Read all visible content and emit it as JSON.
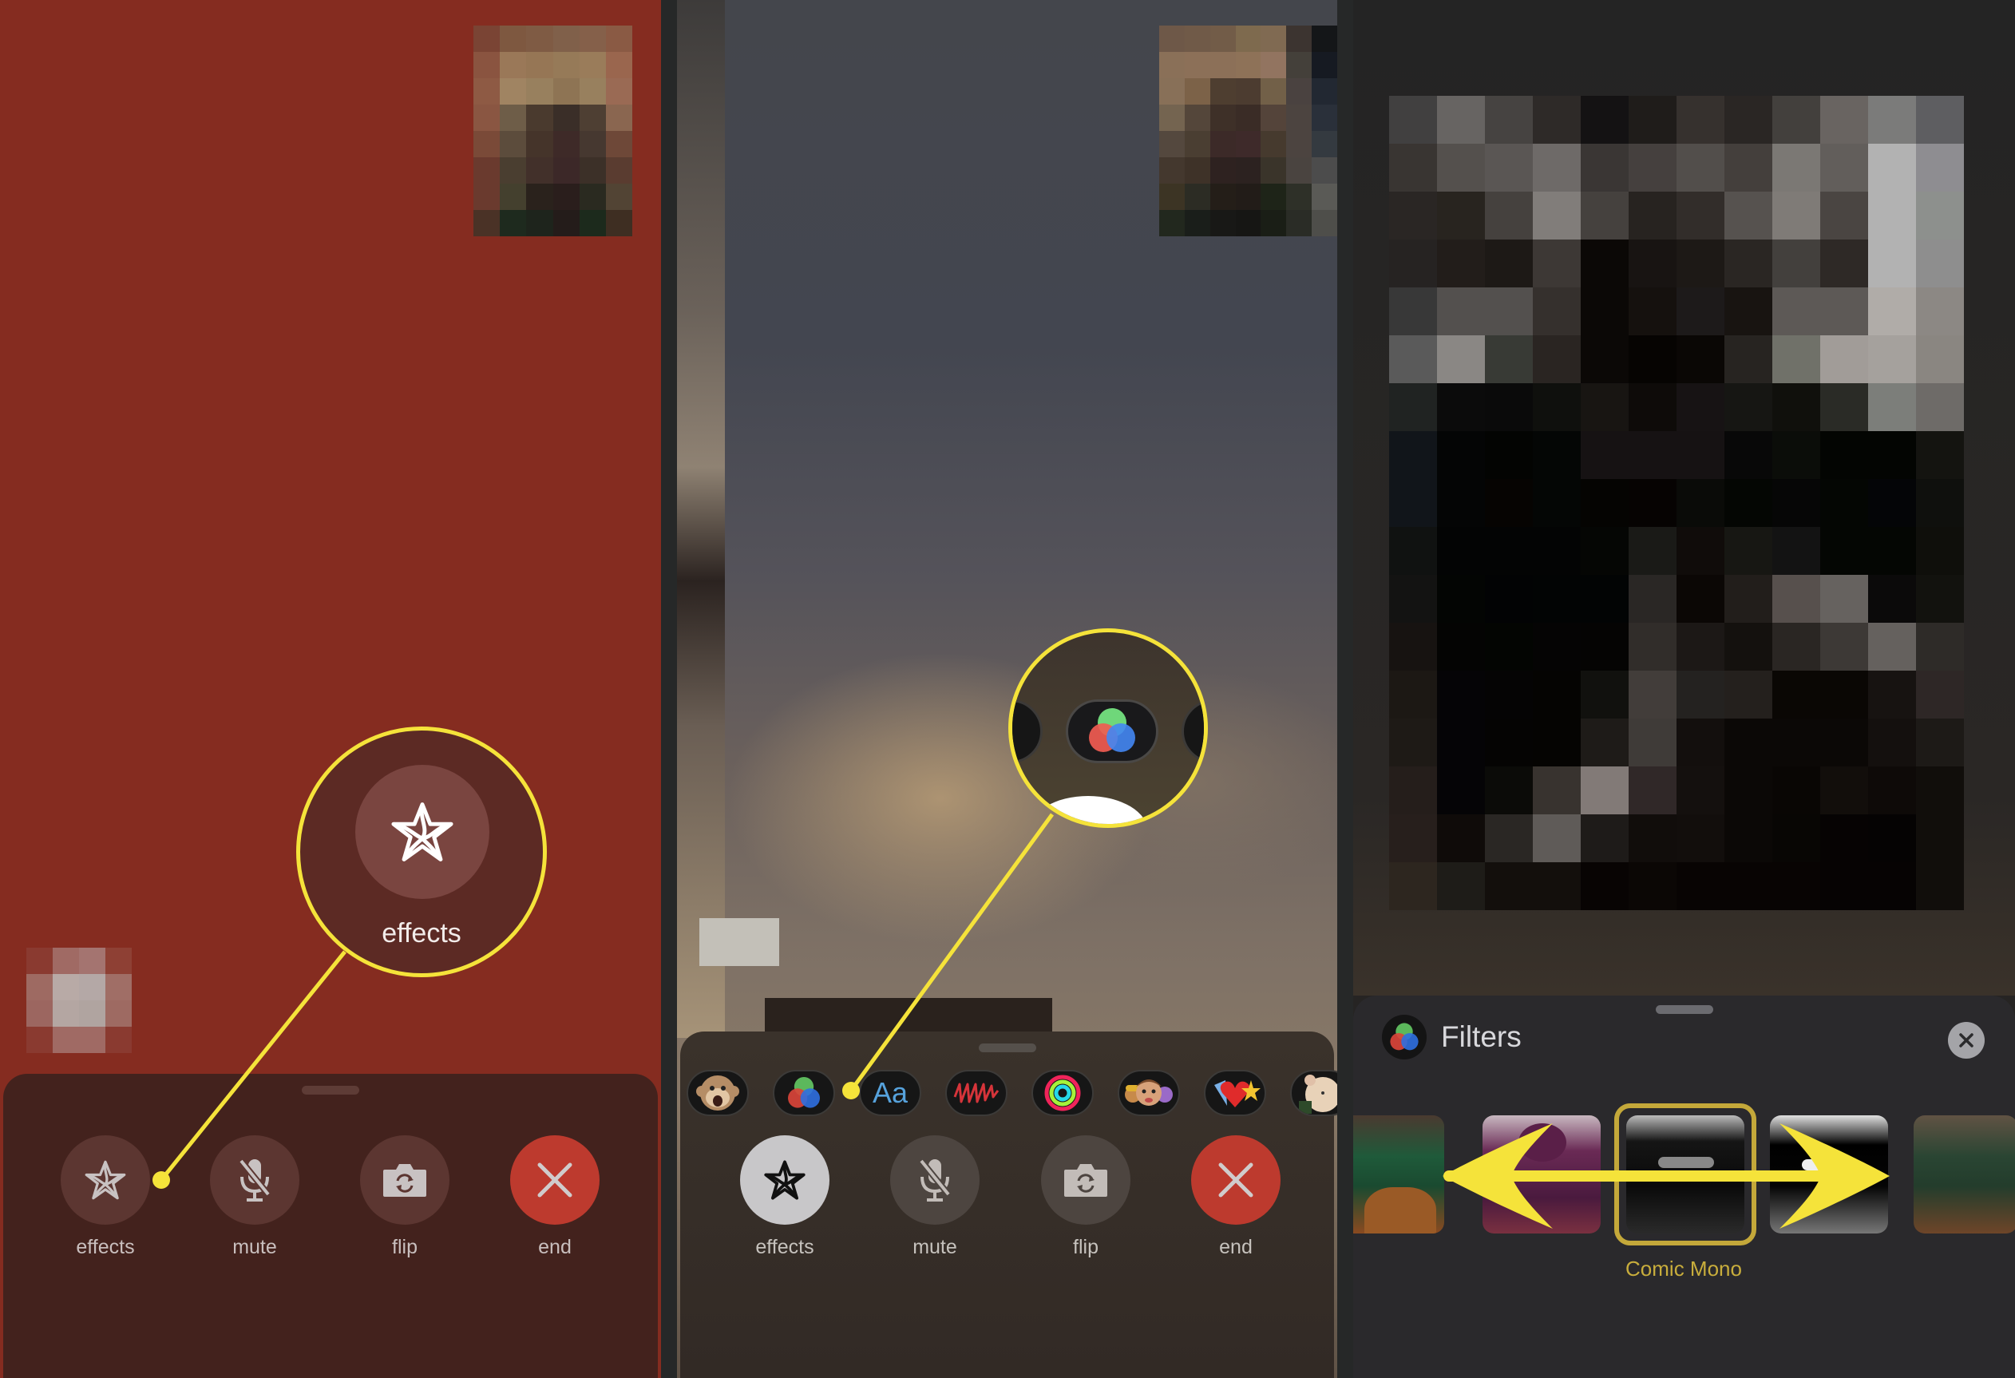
{
  "panel1": {
    "controls": [
      {
        "label": "effects",
        "icon": "effects-star-icon"
      },
      {
        "label": "mute",
        "icon": "mic-slash-icon"
      },
      {
        "label": "flip",
        "icon": "camera-flip-icon"
      },
      {
        "label": "end",
        "icon": "close-x-icon"
      }
    ],
    "callout": {
      "label": "effects",
      "icon": "effects-star-icon"
    }
  },
  "panel2": {
    "effects_tray": [
      {
        "name": "animoji",
        "icon": "monkey-animoji-icon"
      },
      {
        "name": "filters",
        "icon": "filters-rgb-icon"
      },
      {
        "name": "text",
        "icon": "text-aa-icon",
        "label": "Aa"
      },
      {
        "name": "shapes",
        "icon": "scribble-icon"
      },
      {
        "name": "activity-stickers",
        "icon": "activity-rings-icon"
      },
      {
        "name": "memoji-stickers",
        "icon": "memoji-icon"
      },
      {
        "name": "emoji-stickers",
        "icon": "emoji-stickers-icon"
      },
      {
        "name": "more",
        "icon": "hamster-animoji-icon"
      }
    ],
    "controls": [
      {
        "label": "effects",
        "icon": "effects-star-icon",
        "active": true
      },
      {
        "label": "mute",
        "icon": "mic-slash-icon"
      },
      {
        "label": "flip",
        "icon": "camera-flip-icon"
      },
      {
        "label": "end",
        "icon": "close-x-icon"
      }
    ]
  },
  "panel3": {
    "sheet_title": "Filters",
    "filters": [
      {
        "name": "original"
      },
      {
        "name": "comic-color"
      },
      {
        "name": "Comic Mono",
        "selected": true
      },
      {
        "name": "ink"
      },
      {
        "name": "original-2"
      }
    ],
    "selected_filter_label": "Comic Mono"
  },
  "colors": {
    "highlight": "#f5e33a",
    "end_call": "#bd3a2e",
    "selected_filter": "#c4a83a"
  }
}
